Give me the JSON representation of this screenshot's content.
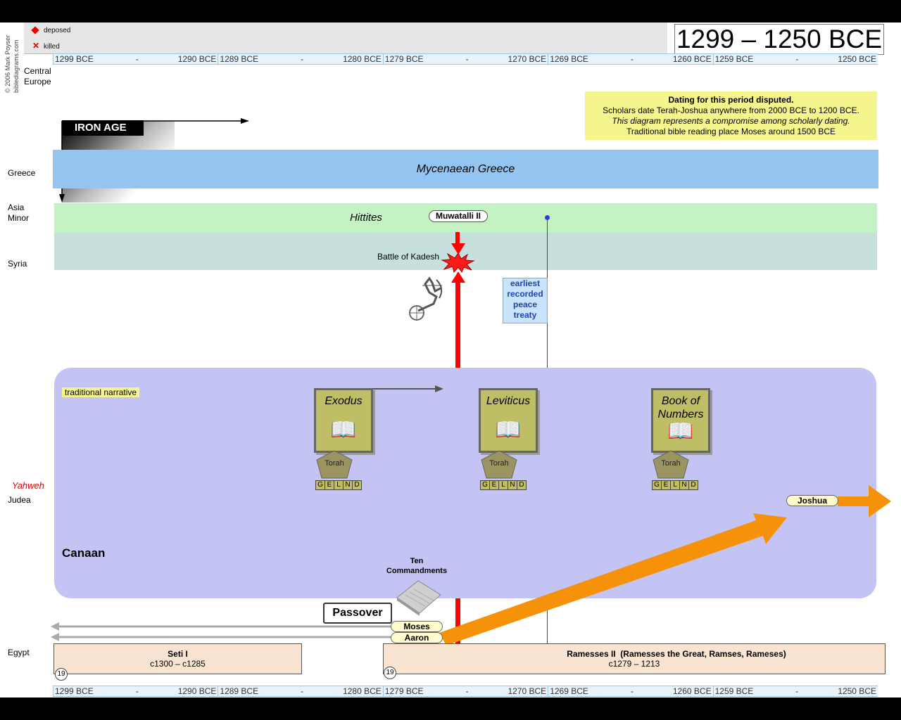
{
  "credit": {
    "line1": "© 2006 Mark Poyser",
    "line2": "biblediagrams.com"
  },
  "legend": {
    "deposed": "deposed",
    "killed": "killed",
    "deposed_color": "#e60000",
    "killed_color": "#e60000"
  },
  "title": "1299 – 1250 BCE",
  "timeline_top": [
    {
      "start": "1299 BCE",
      "dash": "-",
      "end": "1290 BCE"
    },
    {
      "start": "1289 BCE",
      "dash": "-",
      "end": "1280 BCE"
    },
    {
      "start": "1279 BCE",
      "dash": "-",
      "end": "1270 BCE"
    },
    {
      "start": "1269 BCE",
      "dash": "-",
      "end": "1260 BCE"
    },
    {
      "start": "1259 BCE",
      "dash": "-",
      "end": "1250 BCE"
    }
  ],
  "timeline_bottom": [
    {
      "start": "1299 BCE",
      "dash": "-",
      "end": "1290 BCE"
    },
    {
      "start": "1289 BCE",
      "dash": "-",
      "end": "1280 BCE"
    },
    {
      "start": "1279 BCE",
      "dash": "-",
      "end": "1270 BCE"
    },
    {
      "start": "1269 BCE",
      "dash": "-",
      "end": "1260 BCE"
    },
    {
      "start": "1259 BCE",
      "dash": "-",
      "end": "1250 BCE"
    }
  ],
  "regions": {
    "central_europe": "Central\nEurope",
    "greece": "Greece",
    "asia_minor": "Asia\nMinor",
    "syria": "Syria",
    "yahweh": "Yahweh",
    "judea": "Judea",
    "egypt": "Egypt"
  },
  "iron_age": "IRON AGE",
  "note": {
    "l1": "Dating for this period disputed.",
    "l2": "Scholars date Terah-Joshua anywhere from 2000 BCE to 1200 BCE.",
    "l3": "This diagram represents a compromise among scholarly dating.",
    "l4": "Traditional bible reading place Moses around 1500 BCE"
  },
  "bands": {
    "greece": "Mycenaean Greece",
    "hittites": "Hittites"
  },
  "muwatalli": "Muwatalli II",
  "battle": "Battle of Kadesh",
  "treaty": "earliest\nrecorded\npeace\ntreaty",
  "canaan": {
    "traditional": "traditional narrative",
    "label": "Canaan"
  },
  "books": [
    {
      "title": "Exodus",
      "torah": "Torah",
      "gelnd": [
        "G",
        "E",
        "L",
        "N",
        "D"
      ]
    },
    {
      "title": "Leviticus",
      "torah": "Torah",
      "gelnd": [
        "G",
        "E",
        "L",
        "N",
        "D"
      ]
    },
    {
      "title": "Book of\nNumbers",
      "torah": "Torah",
      "gelnd": [
        "G",
        "E",
        "L",
        "N",
        "D"
      ]
    }
  ],
  "joshua": "Joshua",
  "ten_commandments": "Ten\nCommandments",
  "passover": "Passover",
  "moses": "Moses",
  "aaron": "Aaron",
  "rulers": [
    {
      "name": "Seti I",
      "dates": "c1300 – c1285",
      "dynasty": "19"
    },
    {
      "name": "Ramesses II  (Ramesses the Great, Ramses, Rameses)",
      "dates": "c1279 – 1213",
      "dynasty": "19"
    }
  ],
  "colors": {
    "greece_band": "#94c4f0",
    "hittite_band": "#c3f3c3",
    "syria_band": "#c7e0dd",
    "canaan_band": "#c4c4f4",
    "note_bg": "#f5f58e",
    "red_arrow": "#ff0000",
    "orange_arrow": "#f5920a",
    "treaty_line": "#3a3ad0"
  }
}
